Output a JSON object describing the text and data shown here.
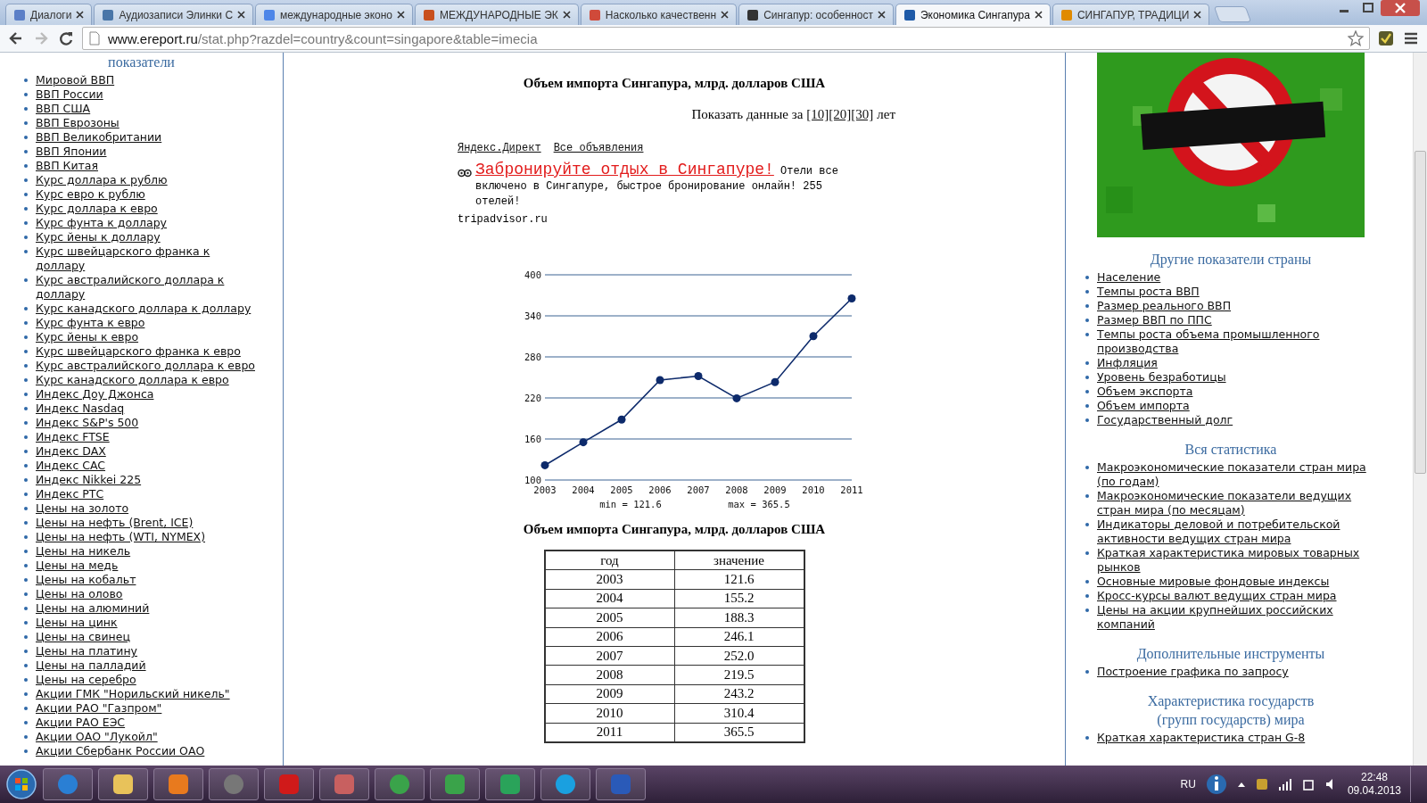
{
  "browser": {
    "tabs": [
      {
        "title": "Диалоги",
        "selected": false
      },
      {
        "title": "Аудиозаписи Элинки С",
        "selected": false
      },
      {
        "title": "международные эконо",
        "selected": false
      },
      {
        "title": "МЕЖДУНАРОДНЫЕ ЭК",
        "selected": false
      },
      {
        "title": "Насколько качественн",
        "selected": false
      },
      {
        "title": "Сингапур: особенност",
        "selected": false
      },
      {
        "title": "Экономика Сингапура",
        "selected": true
      },
      {
        "title": "СИНГАПУР, ТРАДИЦИ",
        "selected": false
      }
    ],
    "address_host": "www.ereport.ru",
    "address_path": "/stat.php?razdel=country&count=singapore&table=imecia"
  },
  "left_sidebar": {
    "heading": "показатели",
    "links": [
      "Мировой ВВП",
      "ВВП России",
      "ВВП США",
      "ВВП Еврозоны",
      "ВВП Великобритании",
      "ВВП Японии",
      "ВВП Китая",
      "Курс доллара к рублю",
      "Курс евро к рублю",
      "Курс доллара к евро",
      "Курс фунта к доллару",
      "Курс йены к доллару",
      "Курс швейцарского франка к доллару",
      "Курс австралийского доллара к доллару",
      "Курс канадского доллара к доллару",
      "Курс фунта к евро",
      "Курс йены к евро",
      "Курс швейцарского франка к евро",
      "Курс австралийского доллара к евро",
      "Курс канадского доллара к евро",
      "Индекс Доу Джонса",
      "Индекс Nasdaq",
      "Индекс S&P's 500",
      "Индекс FTSE",
      "Индекс DAX",
      "Индекс CAC",
      "Индекс Nikkei 225",
      "Индекс РТС",
      "Цены на золото",
      "Цены на нефть (Brent, ICE)",
      "Цены на нефть (WTI, NYMEX)",
      "Цены на никель",
      "Цены на медь",
      "Цены на кобальт",
      "Цены на олово",
      "Цены на алюминий",
      "Цены на цинк",
      "Цены на свинец",
      "Цены на платину",
      "Цены на палладий",
      "Цены на серебро",
      "Акции ГМК \"Норильский никель\"",
      "Акции РАО \"Газпром\"",
      "Акции РАО ЕЭС",
      "Акции ОАО \"Лукойл\"",
      "Акции Сбербанк России ОАО"
    ]
  },
  "main": {
    "title": "Объем импорта Сингапура, млрд. долларов США",
    "period": {
      "label": "Показать данные за",
      "options": [
        "[10]",
        "[20]",
        "[30]"
      ],
      "suffix": "лет"
    },
    "ad": {
      "links": [
        "Яндекс.Директ",
        "Все объявления"
      ],
      "headline": "Забронируйте отдых в Сингапуре!",
      "text": "Отели все включено в Сингапуре, быстрое бронирование онлайн! 255 отелей!",
      "domain": "tripadvisor.ru"
    },
    "chart_data": {
      "type": "line",
      "categories": [
        "2003",
        "2004",
        "2005",
        "2006",
        "2007",
        "2008",
        "2009",
        "2010",
        "2011"
      ],
      "ylim": [
        100,
        400
      ],
      "yticks": [
        100,
        160,
        220,
        280,
        340,
        400
      ],
      "grid": true,
      "series": [
        {
          "color": "#0d2a6b",
          "marker": "circle",
          "values": [
            121.6,
            155.2,
            188.3,
            246.1,
            252.0,
            219.5,
            243.2,
            310.4,
            365.5
          ]
        }
      ]
    },
    "chart_notes": [
      "min = 121.6",
      "max = 365.5"
    ],
    "table": {
      "title": "Объем импорта Сингапура, млрд. долларов США",
      "columns": [
        "год",
        "значение"
      ],
      "rows": [
        [
          "2003",
          "121.6"
        ],
        [
          "2004",
          "155.2"
        ],
        [
          "2005",
          "188.3"
        ],
        [
          "2006",
          "246.1"
        ],
        [
          "2007",
          "252.0"
        ],
        [
          "2008",
          "219.5"
        ],
        [
          "2009",
          "243.2"
        ],
        [
          "2010",
          "310.4"
        ],
        [
          "2011",
          "365.5"
        ]
      ]
    }
  },
  "right_sidebar": {
    "sections": [
      {
        "heading": "Другие показатели страны",
        "links": [
          "Население",
          "Темпы роста ВВП",
          "Размер реального ВВП",
          "Размер ВВП по ППС",
          "Темпы роста объема промышленного производства",
          "Инфляция",
          "Уровень безработицы",
          "Объем экспорта",
          "Объем импорта",
          "Государственный долг"
        ]
      },
      {
        "heading": "Вся статистика",
        "links": [
          "Макроэкономические показатели стран мира (по годам)",
          "Макроэкономические показатели ведущих стран мира (по месяцам)",
          "Индикаторы деловой и потребительской активности ведущих стран мира",
          "Краткая характеристика мировых товарных рынков",
          "Основные мировые фондовые индексы",
          "Кросс-курсы валют ведущих стран мира",
          "Цены на акции крупнейших российских компаний"
        ]
      },
      {
        "heading": "Дополнительные инструменты",
        "links": [
          "Построение графика по запросу"
        ]
      },
      {
        "heading": "Характеристика государств (групп государств) мира",
        "links": [
          "Краткая характеристика стран G-8"
        ]
      }
    ]
  },
  "taskbar": {
    "language": "RU",
    "time": "22:48",
    "date": "09.04.2013"
  }
}
